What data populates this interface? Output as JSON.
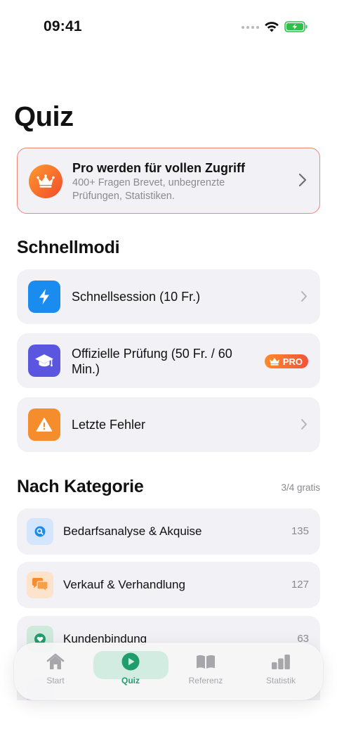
{
  "status_bar": {
    "time": "09:41"
  },
  "page": {
    "title": "Quiz"
  },
  "pro_banner": {
    "title": "Pro werden für vollen Zugriff",
    "subtitle": "400+ Fragen Brevet, unbegrenzte Prüfungen, Statistiken."
  },
  "quick_modes": {
    "section_title": "Schnellmodi",
    "items": [
      {
        "label": "Schnellsession (10 Fr.)",
        "icon": "bolt-icon",
        "color": "#1a8cf0"
      },
      {
        "label": "Offizielle Prüfung (50 Fr. / 60 Min.)",
        "icon": "graduation-cap-icon",
        "color": "#5a56e0",
        "badge": "PRO"
      },
      {
        "label": "Letzte Fehler",
        "icon": "warning-icon",
        "color": "#f58d2c"
      }
    ]
  },
  "categories": {
    "section_title": "Nach Kategorie",
    "meta": "3/4 gratis",
    "items": [
      {
        "label": "Bedarfsanalyse & Akquise",
        "count": "135",
        "icon": "search-icon",
        "color": "#1a8cf0"
      },
      {
        "label": "Verkauf & Verhandlung",
        "count": "127",
        "icon": "chat-bubbles-icon",
        "color": "#f58d2c"
      },
      {
        "label": "Kundenbindung",
        "count": "63",
        "icon": "heart-icon",
        "color": "#1f9e6c"
      }
    ]
  },
  "tab_bar": {
    "tabs": [
      {
        "label": "Start",
        "icon": "home-icon"
      },
      {
        "label": "Quiz",
        "icon": "play-circle-icon",
        "active": true
      },
      {
        "label": "Referenz",
        "icon": "book-icon"
      },
      {
        "label": "Statistik",
        "icon": "bar-chart-icon"
      }
    ]
  },
  "colors": {
    "accent": "#1f9e6c",
    "pro_orange": "#f2533a"
  }
}
